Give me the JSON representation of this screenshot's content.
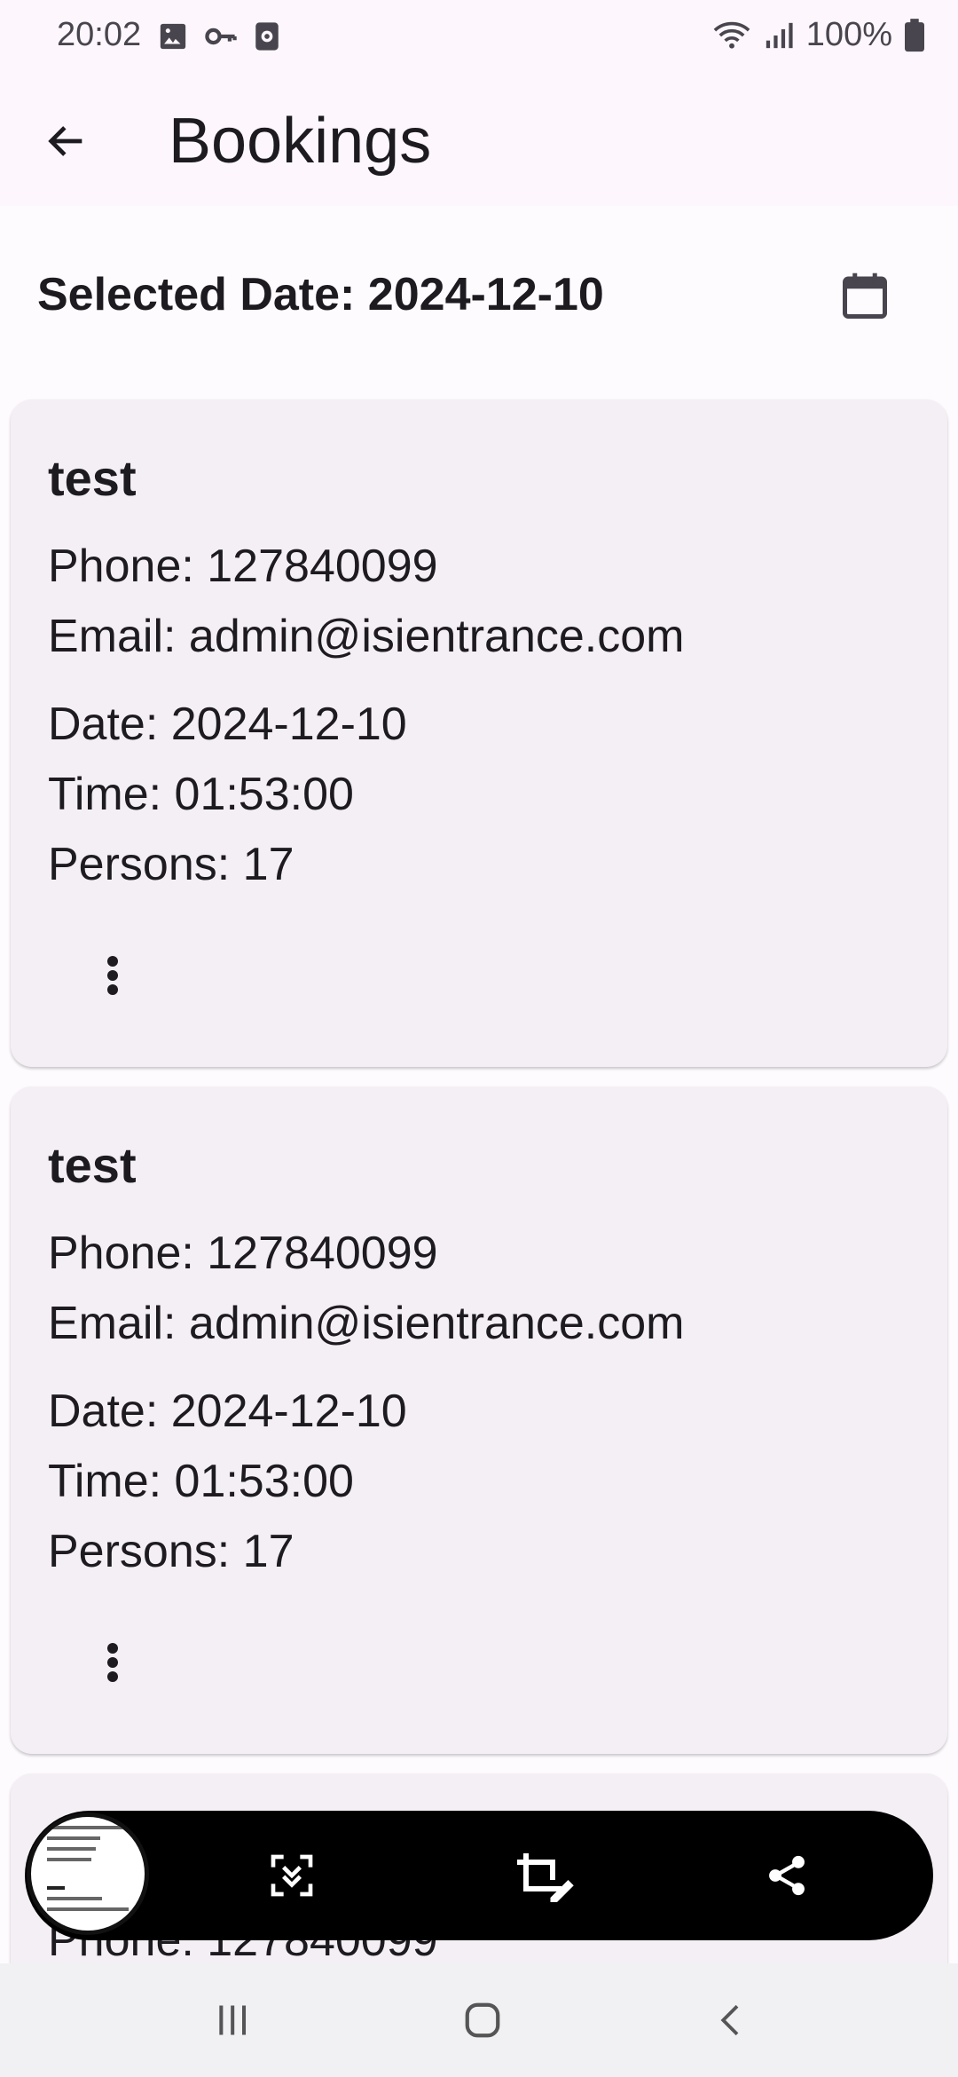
{
  "status_bar": {
    "time": "20:02",
    "battery": "100%",
    "left_icons": [
      "image-icon",
      "key-icon",
      "screen-record-icon"
    ],
    "right_icons": [
      "wifi-icon",
      "signal-icon",
      "battery-icon"
    ]
  },
  "app_bar": {
    "title": "Bookings",
    "back_icon": "arrow-left-icon"
  },
  "date_header": {
    "label": "Selected Date: 2024-12-10",
    "calendar_icon": "calendar-icon"
  },
  "bookings": [
    {
      "name": "test",
      "phone": "Phone: 127840099",
      "email": "Email: admin@isientrance.com",
      "date": "Date: 2024-12-10",
      "time": "Time: 01:53:00",
      "persons": "Persons: 17"
    },
    {
      "name": "test",
      "phone": "Phone: 127840099",
      "email": "Email: admin@isientrance.com",
      "date": "Date: 2024-12-10",
      "time": "Time: 01:53:00",
      "persons": "Persons: 17"
    },
    {
      "phone": "Phone: 127840099"
    }
  ],
  "screenshot_toolbar": {
    "thumbnail_text": [
      "admin@isientrance.com",
      "Date: 2024-12-10",
      "Time: 01:53:00",
      "Persons: 17",
      "test",
      "Phone: 127840099",
      "Email: admin@isientrance.com"
    ],
    "icons": [
      "scroll-capture-icon",
      "crop-edit-icon",
      "share-icon"
    ]
  },
  "nav_bar": {
    "icons": [
      "recent-apps-icon",
      "home-icon",
      "back-nav-icon"
    ]
  },
  "colors": {
    "background": "#fefbff",
    "app_bar": "#fdf7fd",
    "card": "#f4eff4",
    "text": "#1d1b20",
    "toolbar": "#000000",
    "nav_bar": "#f1f0f3"
  }
}
